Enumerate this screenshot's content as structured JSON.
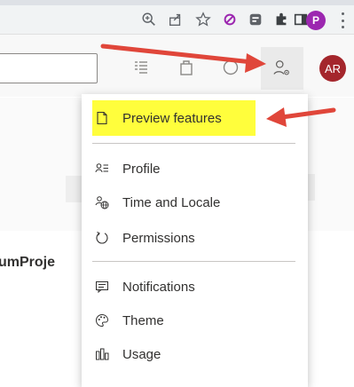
{
  "browser_toolbar": {
    "profile_initial": "P",
    "icons": [
      "zoom-icon",
      "share-icon",
      "star-icon",
      "extension-blocked-icon",
      "extension-icon",
      "puzzle-icon",
      "sidepanel-icon",
      "profile-icon",
      "more-icon"
    ]
  },
  "header": {
    "user_initials": "AR",
    "icons": [
      "list-icon",
      "shopping-bag-icon",
      "help-icon",
      "user-settings-icon"
    ]
  },
  "main": {
    "project_name": "umProje"
  },
  "menu": {
    "items": [
      {
        "label": "Preview features",
        "icon": "page-icon",
        "highlighted": true
      },
      {
        "label": "Profile",
        "icon": "profile-list-icon"
      },
      {
        "label": "Time and Locale",
        "icon": "globe-person-icon"
      },
      {
        "label": "Permissions",
        "icon": "refresh-icon"
      },
      {
        "label": "Notifications",
        "icon": "notification-icon"
      },
      {
        "label": "Theme",
        "icon": "palette-icon"
      },
      {
        "label": "Usage",
        "icon": "usage-chart-icon"
      }
    ]
  },
  "colors": {
    "highlight": "#fffe3c",
    "arrow": "#e0463a",
    "avatar": "#a4262c",
    "chrome_profile": "#9c27b0"
  }
}
